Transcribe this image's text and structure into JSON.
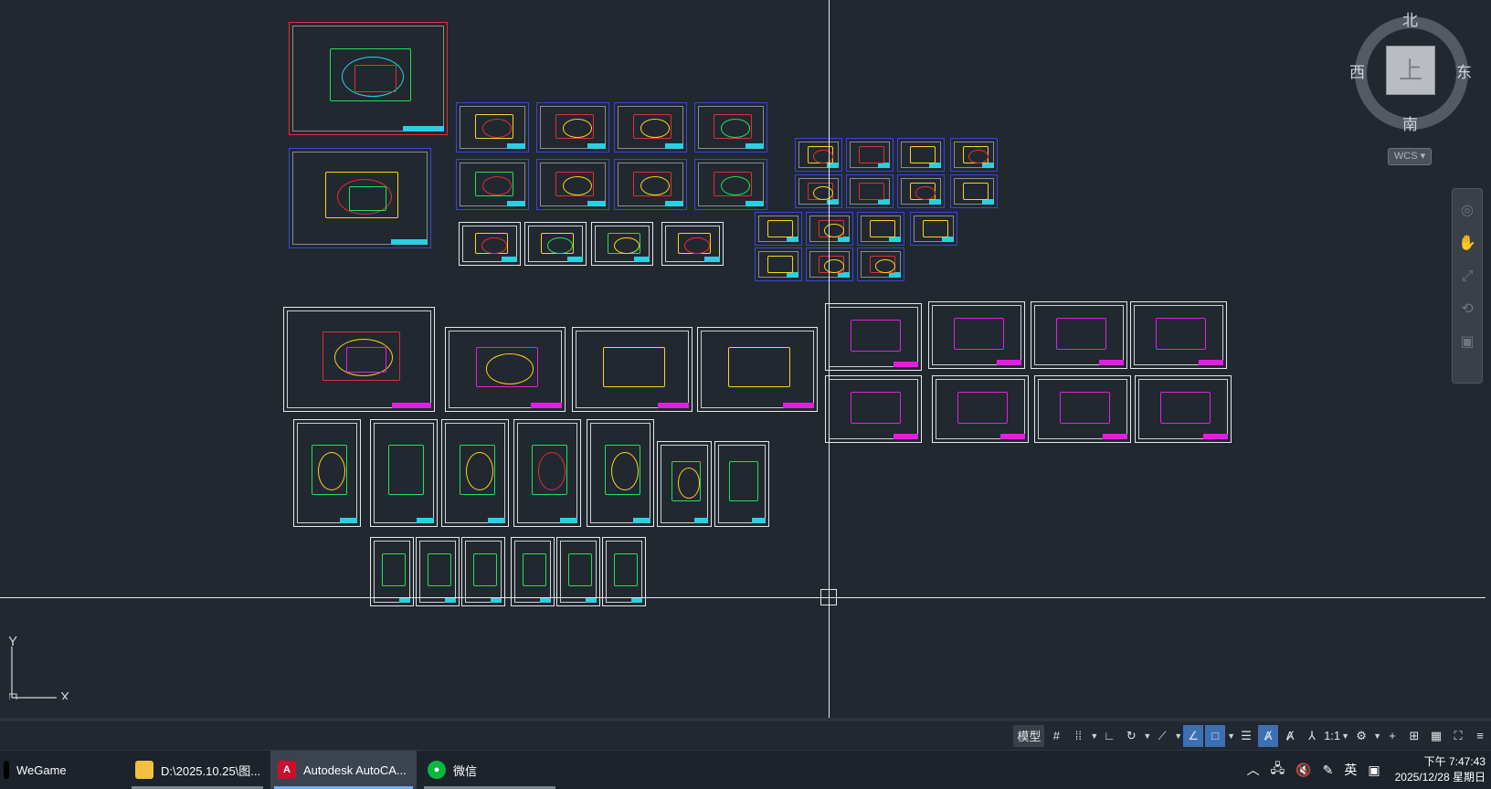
{
  "viewcube": {
    "north": "北",
    "south": "南",
    "west": "西",
    "east": "东",
    "face": "上",
    "wcs_label": "WCS"
  },
  "ucs": {
    "x_label": "X",
    "y_label": "Y"
  },
  "statusbar": {
    "model_label": "模型",
    "scale_label": "1:1"
  },
  "taskbar": {
    "items": [
      {
        "label": "WeGame",
        "icon": "wegame-icon"
      },
      {
        "label": "D:\\2025.10.25\\图...",
        "icon": "folder-icon"
      },
      {
        "label": "Autodesk AutoCA...",
        "icon": "autocad-icon"
      },
      {
        "label": "微信",
        "icon": "wechat-icon"
      }
    ],
    "ime_label": "英",
    "time": "下午 7:47:43",
    "date": "2025/12/28 星期日"
  },
  "colors": {
    "canvas_bg": "#212830",
    "crosshair": "#e8e8e8",
    "active_toggle": "#3d6fb3"
  }
}
